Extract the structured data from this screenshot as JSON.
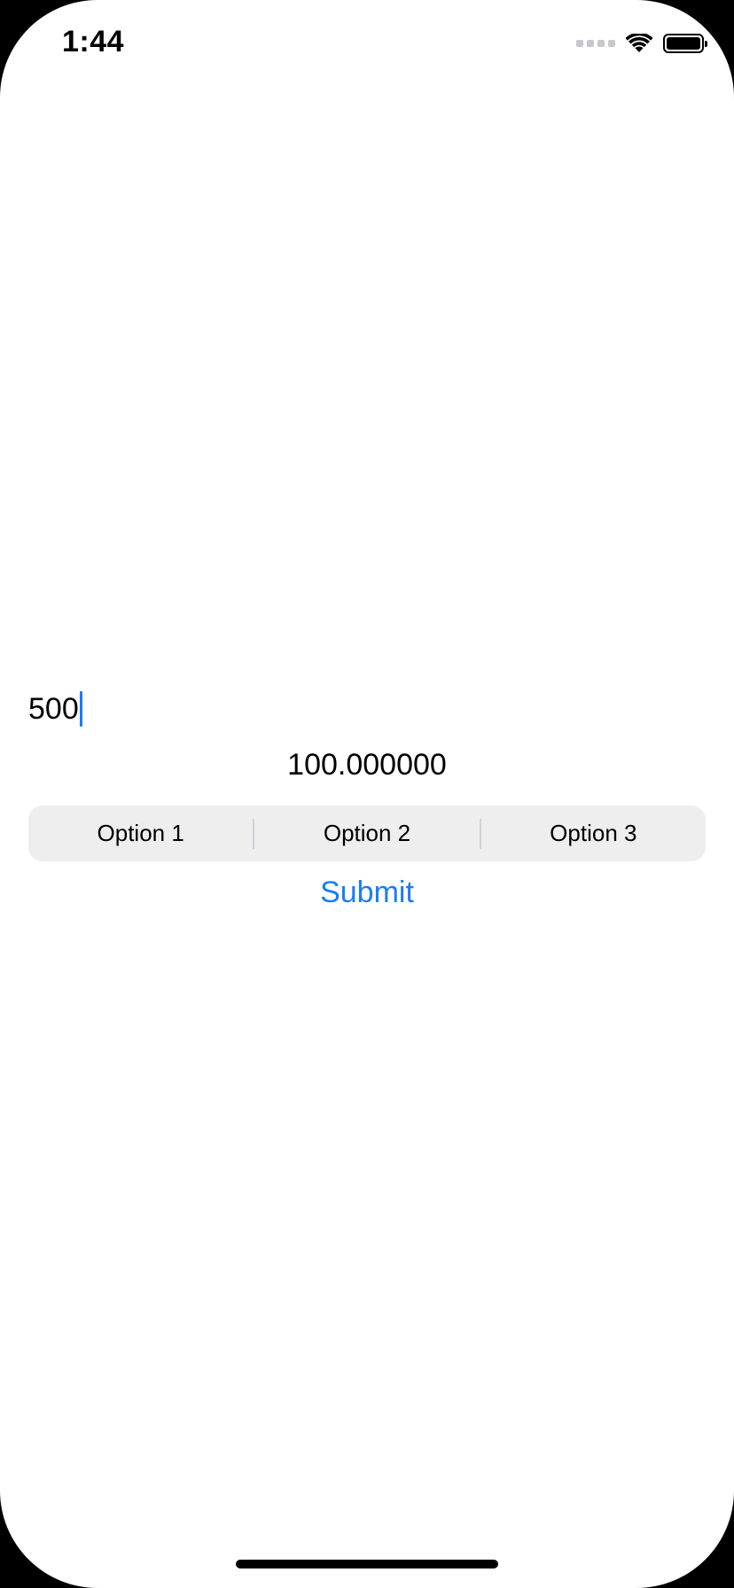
{
  "status_bar": {
    "time": "1:44"
  },
  "form": {
    "input_value": "500",
    "result_text": "100.000000",
    "segments": [
      "Option 1",
      "Option 2",
      "Option 3"
    ],
    "submit_label": "Submit"
  },
  "colors": {
    "accent": "#1a7cf5",
    "segment_background": "#eeeeef"
  }
}
